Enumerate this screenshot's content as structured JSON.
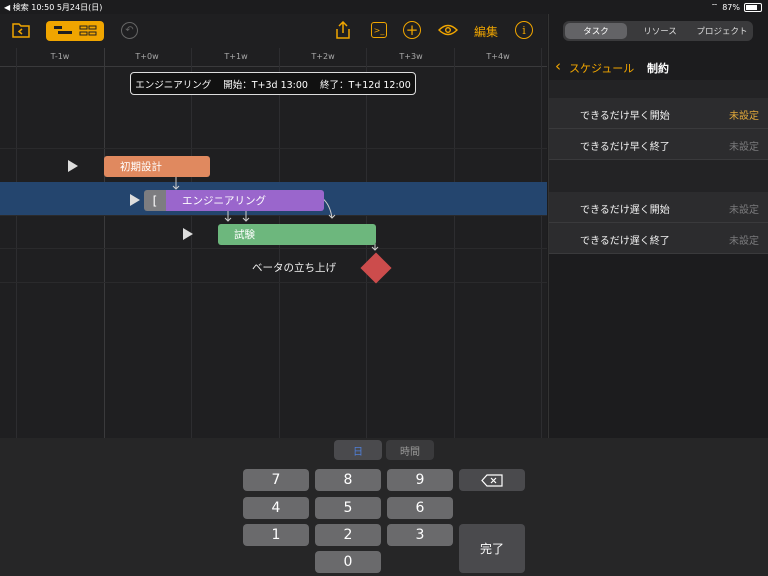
{
  "status": {
    "left": "◀ 検索  10:50  5月24日(日)",
    "battery": "87%"
  },
  "toolbar": {
    "edit_label": "編集"
  },
  "timeline": {
    "ticks": [
      "T-1w",
      "T+0w",
      "T+1w",
      "T+2w",
      "T+3w",
      "T+4w"
    ]
  },
  "tooltip": {
    "task": "エンジニアリング",
    "start": "開始：T+3d 13:00",
    "end": "終了：T+12d 12:00"
  },
  "tasks": [
    {
      "label": "初期設計",
      "color": "#e0895f"
    },
    {
      "label": "エンジニアリング",
      "color": "#9a66cc"
    },
    {
      "label": "試験",
      "color": "#6db77d"
    },
    {
      "label": "ベータの立ち上げ",
      "color": "#cc4c4c"
    }
  ],
  "inspector": {
    "segments": [
      "タスク",
      "リソース",
      "プロジェクト"
    ],
    "back_label": "スケジュール",
    "title": "制約",
    "rows": [
      {
        "label": "できるだけ早く開始",
        "value": "未設定"
      },
      {
        "label": "できるだけ早く終了",
        "value": "未設定"
      },
      {
        "label": "できるだけ遅く開始",
        "value": "未設定"
      },
      {
        "label": "できるだけ遅く終了",
        "value": "未設定"
      }
    ]
  },
  "keyboard": {
    "tabs": [
      "日",
      "時間"
    ],
    "keys": [
      "7",
      "8",
      "9",
      "4",
      "5",
      "6",
      "1",
      "2",
      "3",
      "0"
    ],
    "done_label": "完了"
  }
}
